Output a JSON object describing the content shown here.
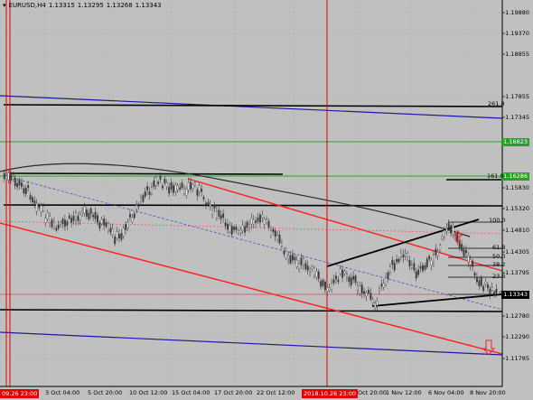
{
  "header": {
    "symbol": "EURUSD,H4",
    "open": "1.13315",
    "high": "1.13295",
    "low": "1.13268",
    "close": "1.13343"
  },
  "price_axis": [
    "1.19880",
    "1.19370",
    "1.18855",
    "1.17855",
    "1.17345",
    "1.15830",
    "1.15320",
    "1.14810",
    "1.14305",
    "1.13795",
    "1.12780",
    "1.12290",
    "1.11785"
  ],
  "price_tags": {
    "green_level": "1.16823",
    "green_level_2": "1.16286",
    "current": "1.13343"
  },
  "fibo_labels": [
    "261.8",
    "161.8",
    "100.0",
    "61.8",
    "50.0",
    "38.2",
    "23.6",
    "0.0"
  ],
  "time_axis": [
    "3 Oct 04:00",
    "5 Oct 20:00",
    "10 Oct 12:00",
    "15 Oct 04:00",
    "17 Oct 20:00",
    "22 Oct 12:00",
    "Oct 20:00",
    "1 Nov 12:00",
    "6 Nov 04:00",
    "8 Nov 20:00"
  ],
  "time_markers": {
    "left": "09.26 23:00",
    "mid": "2018.10.26 23:00"
  },
  "colors": {
    "background": "#c0c0c0",
    "grid": "#a8a8a8",
    "candles": "#3c3c3c",
    "red_channel": "#ff1f1f",
    "blue_line": "#1a1aa0",
    "green_level": "#1fa81f",
    "black_level": "#000000",
    "marker": "#e00000"
  }
}
